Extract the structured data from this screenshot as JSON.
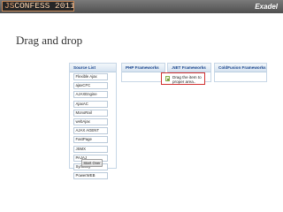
{
  "banner": {
    "logo_prefix": "JS",
    "logo_main": "CONFESS 2011",
    "brand": "Exadel"
  },
  "slide": {
    "title": "Drag and drop"
  },
  "panels": {
    "source_list": {
      "header": "Source List",
      "items": [
        "Flexible Ajax",
        "ajaxCFC",
        "AJAXEngine",
        "AjaxAC",
        "MonoRail",
        "webAjax",
        "AJAX AGENT",
        "FastPage",
        "JSMX",
        "PAJAJ",
        "Symfony",
        "PowerWEB"
      ],
      "start_over": "Start Over"
    },
    "php": {
      "header": "PHP Frameworks"
    },
    "net": {
      "header": ".NET Frameworks",
      "drag_item": "Drag the item to proper area.."
    },
    "cf": {
      "header": "ColdFusion Frameworks"
    }
  },
  "colors": {
    "panel_header_text": "#15428b",
    "drag_border": "#d23030",
    "logo_text": "#e8a878"
  }
}
